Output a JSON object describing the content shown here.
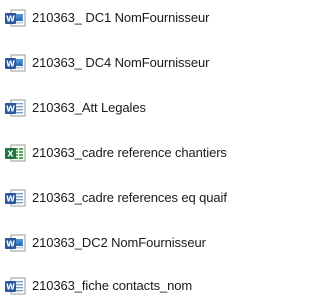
{
  "files": [
    {
      "name": "210363_ DC1 NomFournisseur",
      "icon": "word-doc-pictogram-icon",
      "type": "word-special"
    },
    {
      "name": "210363_ DC4 NomFournisseur",
      "icon": "word-doc-pictogram-icon",
      "type": "word-special"
    },
    {
      "name": "210363_Att Legales",
      "icon": "word-doc-icon",
      "type": "word"
    },
    {
      "name": "210363_cadre reference chantiers",
      "icon": "excel-xls-icon",
      "type": "excel"
    },
    {
      "name": "210363_cadre references eq quaif",
      "icon": "word-doc-icon",
      "type": "word"
    },
    {
      "name": "210363_DC2 NomFournisseur",
      "icon": "word-doc-pictogram-icon",
      "type": "word-special"
    },
    {
      "name": "210363_fiche contacts_nom",
      "icon": "word-doc-icon",
      "type": "word"
    }
  ],
  "colors": {
    "word_blue": "#2b579a",
    "excel_green": "#217346",
    "text": "#1a1a1a"
  }
}
